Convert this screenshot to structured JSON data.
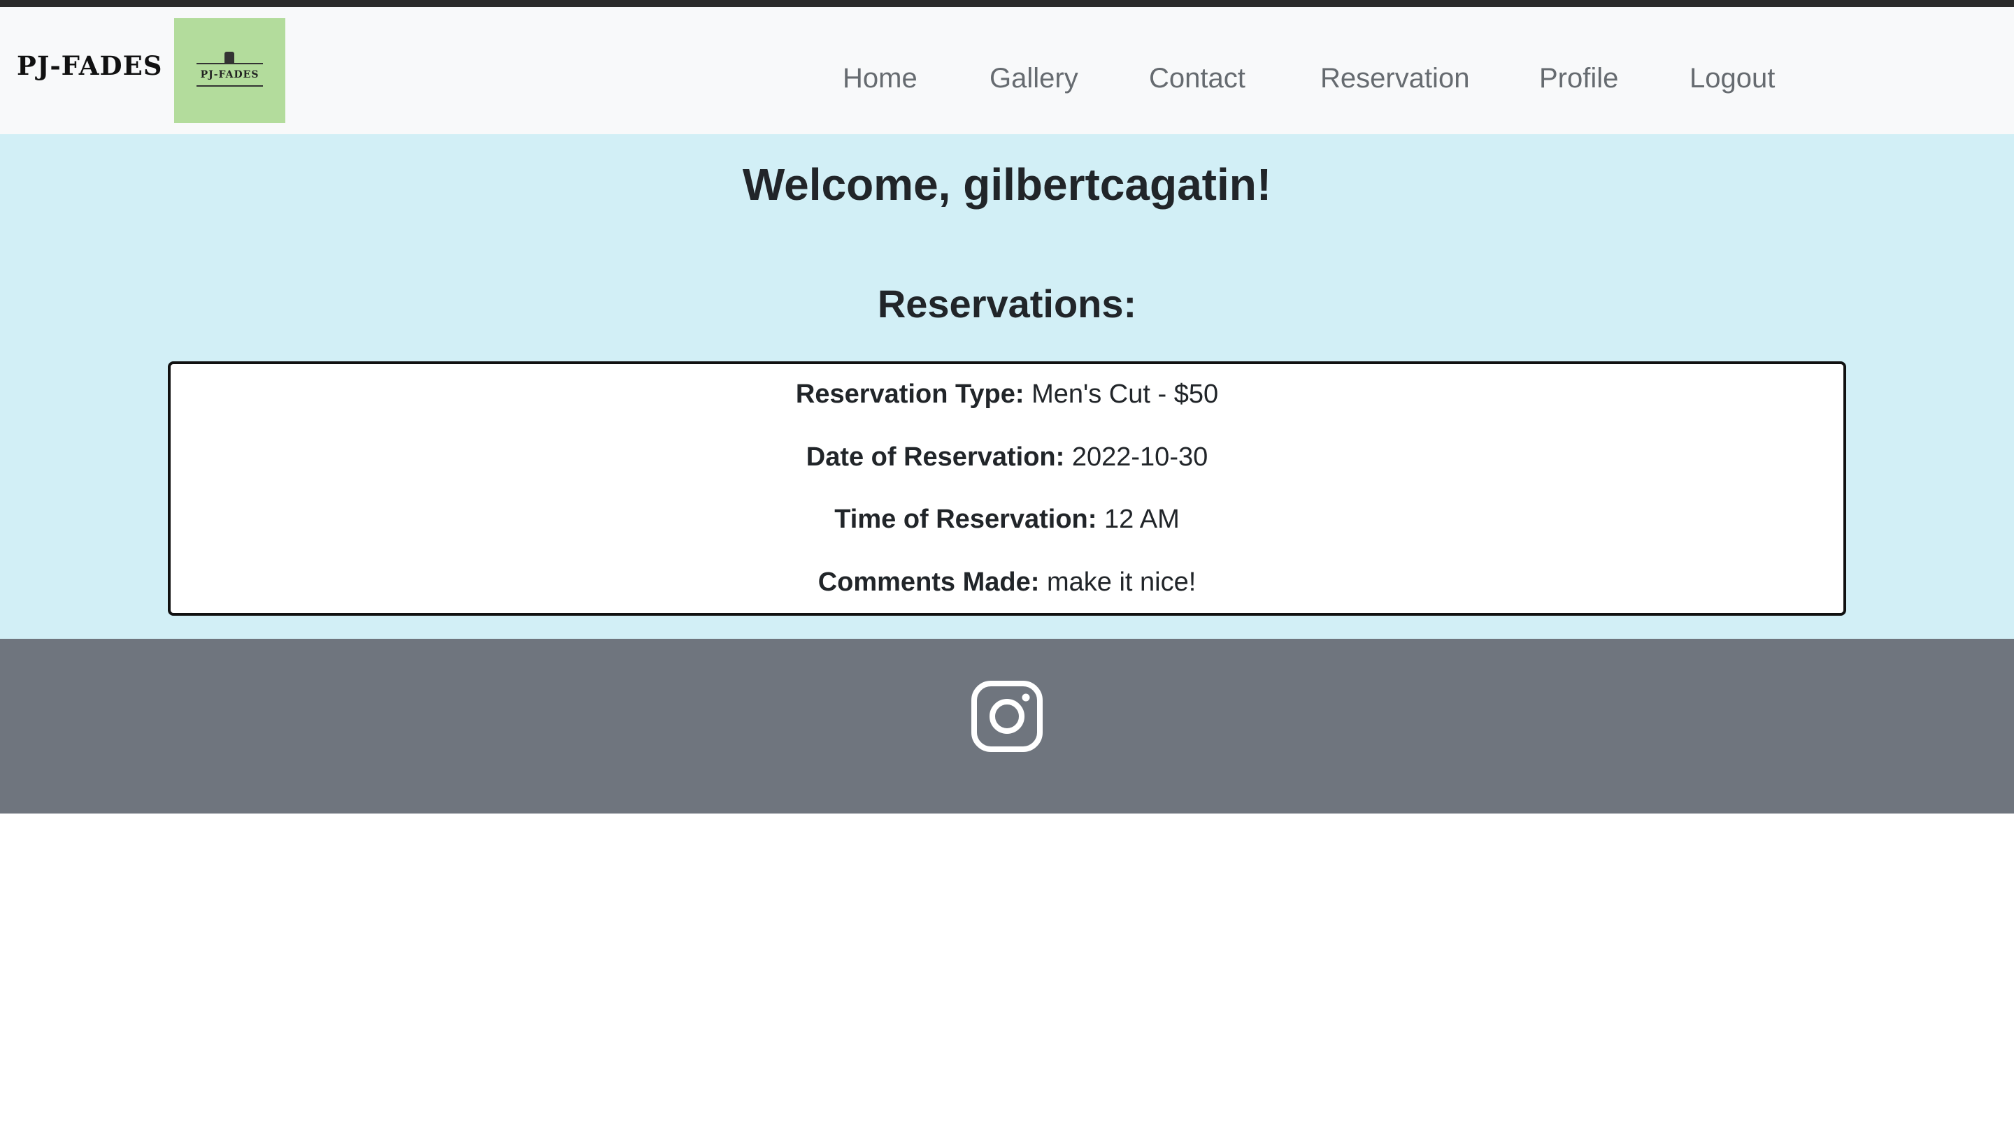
{
  "brand": {
    "name": "PJ-FADES",
    "logo_text": "PJ-FADES",
    "logo_bg_color": "#b3dc9c"
  },
  "nav": {
    "items": [
      {
        "label": "Home"
      },
      {
        "label": "Gallery"
      },
      {
        "label": "Contact"
      },
      {
        "label": "Reservation"
      },
      {
        "label": "Profile"
      },
      {
        "label": "Logout"
      }
    ]
  },
  "main": {
    "welcome": "Welcome, gilbertcagatin!",
    "reservations_heading": "Reservations:",
    "bg_color": "#d2eff6",
    "reservation": {
      "type_label": "Reservation Type:",
      "type_value": "Men's Cut - $50",
      "date_label": "Date of Reservation:",
      "date_value": "2022-10-30",
      "time_label": "Time of Reservation:",
      "time_value": "12 AM",
      "comments_label": "Comments Made:",
      "comments_value": "make it nice!"
    }
  },
  "footer": {
    "icon": "instagram-icon",
    "bg_color": "#6f757e"
  }
}
